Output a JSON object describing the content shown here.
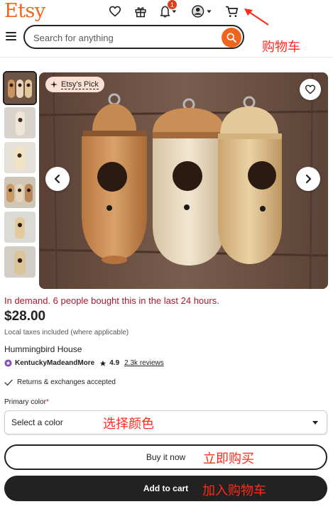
{
  "header": {
    "logo": "Etsy",
    "notification_count": "1",
    "search_placeholder": "Search for anything"
  },
  "listing": {
    "badge": "Etsy's Pick",
    "demand_text": "In demand. 6 people bought this in the last 24 hours.",
    "price": "$28.00",
    "tax_note": "Local taxes included (where applicable)",
    "title": "Hummingbird House",
    "shop_name": "KentuckyMadeandMore",
    "rating": "4.9",
    "reviews": "2.3k reviews",
    "returns": "Returns & exchanges accepted"
  },
  "variation": {
    "label": "Primary color",
    "required_mark": "*",
    "selected": "Select a color"
  },
  "actions": {
    "buy_now": "Buy it now",
    "add_to_cart": "Add to cart"
  },
  "annotations": {
    "cart": "购物车",
    "select_color": "选择颜色",
    "buy_now": "立即购买",
    "add_to_cart": "加入购物车"
  },
  "colors": {
    "brand": "#f1641e",
    "demand_red": "#a61a2e",
    "annotation_red": "#ff2a1a",
    "dark": "#222222"
  },
  "icons": [
    "heart-icon",
    "gift-icon",
    "bell-icon",
    "account-icon",
    "cart-icon",
    "menu-icon",
    "search-icon",
    "sparkle-icon",
    "chevron-left-icon",
    "chevron-right-icon",
    "star-icon",
    "check-icon",
    "caret-down-icon"
  ]
}
